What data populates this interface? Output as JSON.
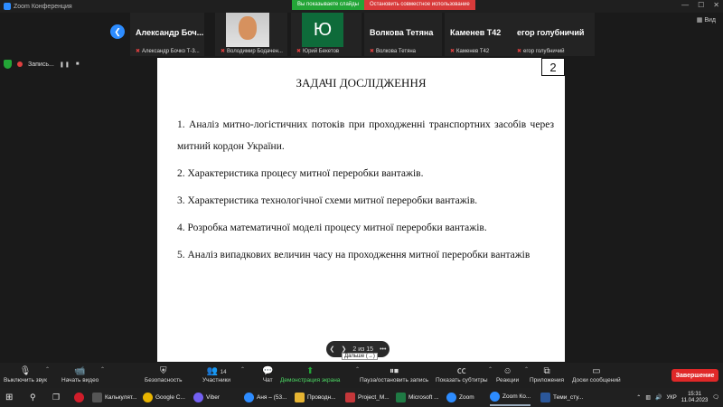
{
  "window": {
    "title": "Zoom Конференция",
    "share_status": "Вы показываете слайды",
    "stop_share": "Остановить совместное использование"
  },
  "gallery": {
    "tiles": [
      {
        "display": "Александр  Боч...",
        "label": "Александр Бочко Т-3..."
      },
      {
        "display": "",
        "label": "Володимир Бодачен..."
      },
      {
        "display": "Ю",
        "label": "Юрий Бекетов"
      },
      {
        "display": "Волкова Тетяна",
        "label": "Волкова Тетяна"
      },
      {
        "display": "Каменев Т42",
        "label": "Каменев Т42"
      },
      {
        "display": "егор голубничий",
        "label": "егор голубничий"
      }
    ],
    "view_label": "Вид"
  },
  "status": {
    "recording_label": "Запись..."
  },
  "slide": {
    "number": "2",
    "title": "ЗАДАЧІ ДОСЛІДЖЕННЯ",
    "items": [
      "1.  Аналіз митно-логістичних потоків при проходженні   транспортних засобів через митний кордон України.",
      "2.    Характеристика процесу митної переробки вантажів.",
      "3.     Характеристика технологічної схеми  митної переробки вантажів.",
      "4.     Розробка математичної моделі процесу митної переробки вантажів.",
      "5.  Аналіз випадкових величин часу на проходження митної переробки вантажів"
    ],
    "nav_counter": "2 из 15",
    "next_tooltip": "Дальше (→)"
  },
  "toolbar": {
    "mute": "Выключить звук",
    "video": "Начать видео",
    "security": "Безопасность",
    "participants": "Участники",
    "participants_count": "14",
    "chat": "Чат",
    "share": "Демонстрация экрана",
    "pause_rec": "Пауза/остановить запись",
    "subtitles": "Показать субтитры",
    "reactions": "Реакции",
    "apps": "Приложения",
    "whiteboards": "Доски сообщений",
    "end": "Завершение"
  },
  "taskbar": {
    "items": [
      "Калькулят...",
      "Google C...",
      "Viber",
      "Аня – (53...",
      "Проводн...",
      "Project_M...",
      "Microsoft ...",
      "Zoom",
      "Zoom Ко...",
      "Теми_сту..."
    ],
    "lang": "УКР",
    "time": "15:31",
    "date": "11.04.2023"
  }
}
